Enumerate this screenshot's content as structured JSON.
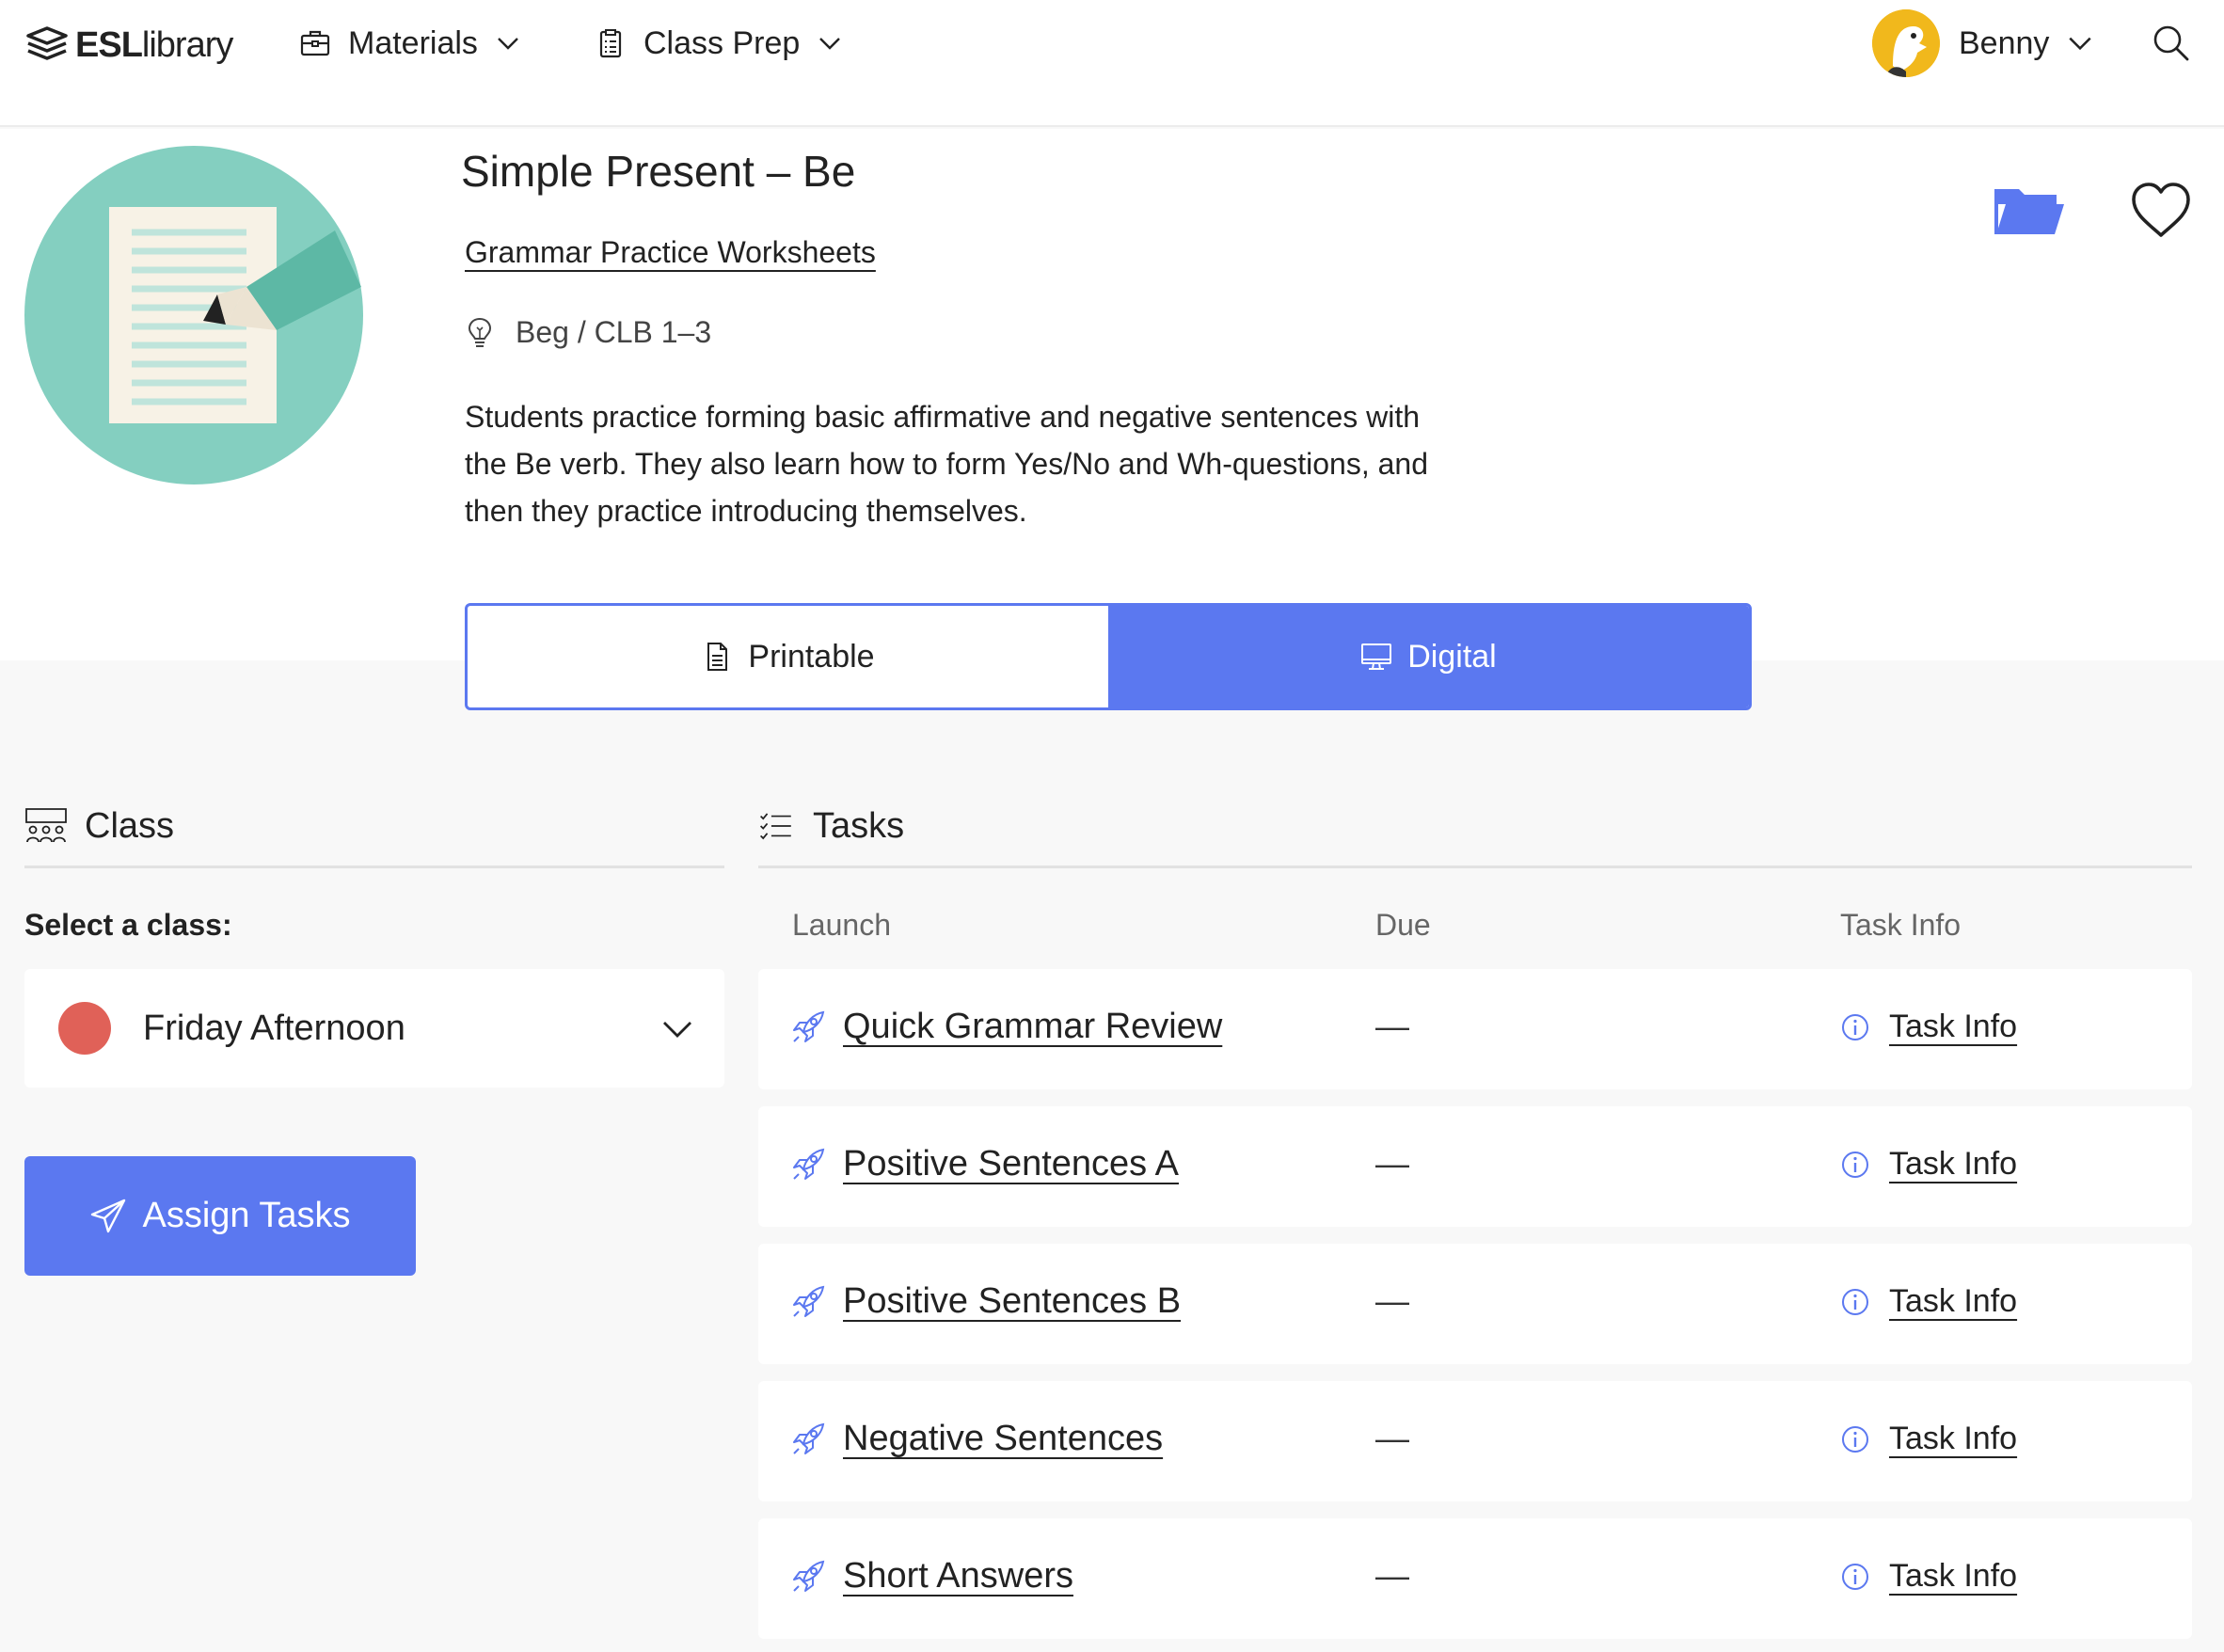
{
  "header": {
    "logo_bold": "ESL",
    "logo_rest": "library",
    "nav": [
      {
        "label": "Materials",
        "icon": "briefcase-icon"
      },
      {
        "label": "Class Prep",
        "icon": "clipboard-icon"
      }
    ],
    "user_name": "Benny"
  },
  "lesson": {
    "title": "Simple Present – Be",
    "category": "Grammar Practice Worksheets",
    "level": "Beg / CLB 1–3",
    "description": "Students practice forming basic affirmative and negative sentences with the Be verb. They also learn how to form Yes/No and Wh-questions, and then they practice introducing themselves."
  },
  "mode_toggle": {
    "printable": "Printable",
    "digital": "Digital",
    "selected": "Digital"
  },
  "class_panel": {
    "heading": "Class",
    "select_label": "Select a class:",
    "selected_class": "Friday Afternoon",
    "class_color": "#e06158",
    "assign_button": "Assign Tasks"
  },
  "tasks_panel": {
    "heading": "Tasks",
    "columns": {
      "launch": "Launch",
      "due": "Due",
      "info": "Task Info"
    },
    "rows": [
      {
        "name": "Quick Grammar Review",
        "due": "—",
        "info": "Task Info"
      },
      {
        "name": "Positive Sentences A",
        "due": "—",
        "info": "Task Info"
      },
      {
        "name": "Positive Sentences B",
        "due": "—",
        "info": "Task Info"
      },
      {
        "name": "Negative Sentences",
        "due": "—",
        "info": "Task Info"
      },
      {
        "name": "Short Answers",
        "due": "—",
        "info": "Task Info"
      }
    ]
  },
  "colors": {
    "accent": "#5b78f0",
    "illustration_teal": "#84cfc0"
  }
}
